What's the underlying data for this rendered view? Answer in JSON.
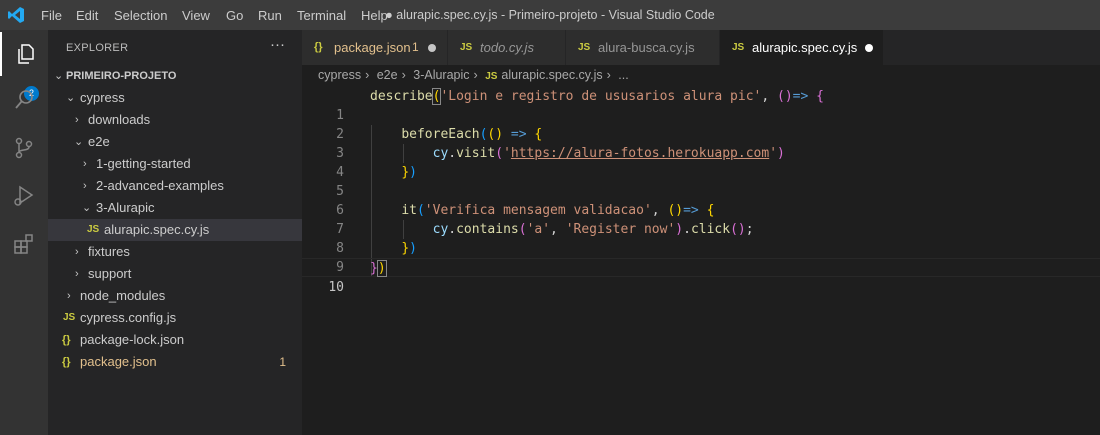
{
  "titlebar": {
    "menu": [
      "File",
      "Edit",
      "Selection",
      "View",
      "Go",
      "Run",
      "Terminal",
      "Help"
    ],
    "window_title": "● alurapic.spec.cy.js - Primeiro-projeto - Visual Studio Code"
  },
  "activitybar": {
    "items": [
      "files-icon",
      "search-icon",
      "source-control-icon",
      "run-debug-icon",
      "extensions-icon"
    ],
    "explorer_badge": "2",
    "accent": "#007acc"
  },
  "sidebar": {
    "title": "EXPLORER",
    "more": "···",
    "project": "PRIMEIRO-PROJETO",
    "tree": [
      {
        "label": "cypress",
        "twisty": "⌄"
      },
      {
        "label": "downloads",
        "twisty": "›"
      },
      {
        "label": "e2e",
        "twisty": "⌄"
      },
      {
        "label": "1-getting-started",
        "twisty": "›"
      },
      {
        "label": "2-advanced-examples",
        "twisty": "›"
      },
      {
        "label": "3-Alurapic",
        "twisty": "⌄"
      },
      {
        "label": "alurapic.spec.cy.js",
        "icon": "JS"
      },
      {
        "label": "fixtures",
        "twisty": "›"
      },
      {
        "label": "support",
        "twisty": "›"
      },
      {
        "label": "node_modules",
        "twisty": "›"
      },
      {
        "label": "cypress.config.js",
        "icon": "JS"
      },
      {
        "label": "package-lock.json",
        "icon": "{}"
      },
      {
        "label": "package.json",
        "icon": "{}",
        "problems": "1"
      }
    ]
  },
  "tabs": [
    {
      "label": "package.json",
      "icon": "{}",
      "badge": "1"
    },
    {
      "label": "todo.cy.js",
      "icon": "JS"
    },
    {
      "label": "alura-busca.cy.js",
      "icon": "JS"
    },
    {
      "label": "alurapic.spec.cy.js",
      "icon": "JS"
    }
  ],
  "breadcrumb": [
    "cypress",
    "e2e",
    "3-Alurapic",
    "JS",
    "alurapic.spec.cy.js",
    "..."
  ],
  "editor": {
    "line_numbers": [
      "1",
      "2",
      "3",
      "4",
      "5",
      "6",
      "7",
      "8",
      "9",
      "10"
    ],
    "code": {
      "l1_fn": "describe",
      "l1_str": "'Login e registro de ususarios alura pic'",
      "l3_fn": "beforeEach",
      "l4_obj": "cy",
      "l4_fn": "visit",
      "l4_str_open": "'",
      "l4_url": "https://alura-fotos.herokuapp.com",
      "l4_str_close": "'",
      "l7_fn": "it",
      "l7_str": "'Verifica mensagem validacao'",
      "l8_obj": "cy",
      "l8_fn": "contains",
      "l8_str1": "'a'",
      "l8_str2": "'Register now'",
      "l8_fn2": "click"
    }
  }
}
